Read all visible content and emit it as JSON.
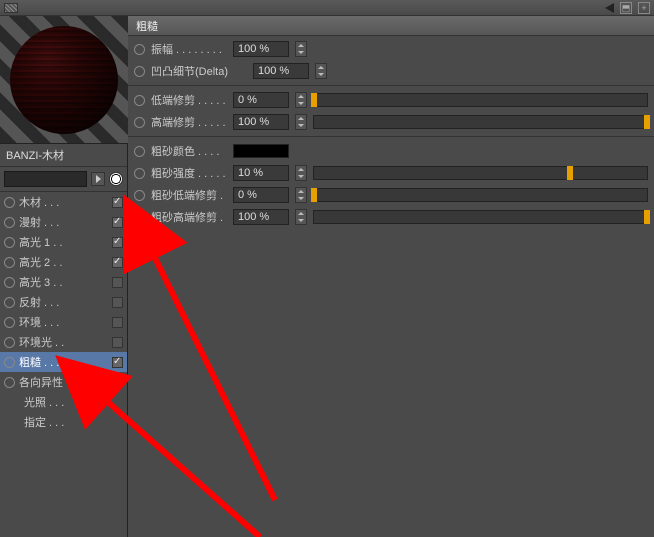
{
  "material_name": "BANZI-木材",
  "panel_title": "粗糙",
  "attributes": [
    {
      "label": "木材 . . .",
      "checked": true
    },
    {
      "label": "漫射 . . .",
      "checked": true
    },
    {
      "label": "高光 1 . .",
      "checked": true
    },
    {
      "label": "高光 2 . .",
      "checked": true
    },
    {
      "label": "高光 3 . .",
      "checked": false
    },
    {
      "label": "反射 . . .",
      "checked": false
    },
    {
      "label": "环境 . . .",
      "checked": false
    },
    {
      "label": "环境光 . .",
      "checked": false
    },
    {
      "label": "粗糙 . . .",
      "checked": true,
      "selected": true
    },
    {
      "label": "各向异性",
      "checked": false
    },
    {
      "label": "光照 . . .",
      "noradio": true
    },
    {
      "label": "指定 . . .",
      "noradio": true
    }
  ],
  "params_group1": [
    {
      "label": "振幅 . . . . . . . .",
      "value": "100 %",
      "slider": false
    },
    {
      "label": "凹凸细节(Delta)",
      "value": "100 %",
      "slider": false,
      "wide": true
    }
  ],
  "params_group2": [
    {
      "label": "低端修剪 . . . . .",
      "value": "0 %",
      "slider": true,
      "thumb": 0
    },
    {
      "label": "高端修剪 . . . . .",
      "value": "100 %",
      "slider": true,
      "thumb": 100
    }
  ],
  "params_group3": [
    {
      "label": "粗砂颜色 . . . .",
      "color": "#000000"
    },
    {
      "label": "粗砂强度 . . . . .",
      "value": "10 %",
      "slider": true,
      "thumb": 77
    },
    {
      "label": "粗砂低端修剪 . .",
      "value": "0 %",
      "slider": true,
      "thumb": 0
    },
    {
      "label": "粗砂高端修剪 . .",
      "value": "100 %",
      "slider": true,
      "thumb": 100
    }
  ]
}
